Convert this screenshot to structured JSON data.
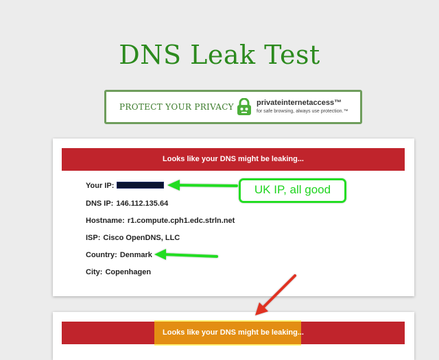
{
  "header": {
    "title": "DNS Leak Test"
  },
  "ad": {
    "tagline": "PROTECT YOUR PRIVACY",
    "brand": "privateinternetaccess™",
    "brand_sub": "for safe browsing, always use protection.™",
    "icon": "lock-icon"
  },
  "result_card": {
    "banner": "Looks like your DNS might be leaking...",
    "fields": [
      {
        "label": "Your IP:",
        "value": ""
      },
      {
        "label": "DNS IP:",
        "value": "146.112.135.64"
      },
      {
        "label": "Hostname:",
        "value": "r1.compute.cph1.edc.strln.net"
      },
      {
        "label": "ISP:",
        "value": "Cisco OpenDNS, LLC"
      },
      {
        "label": "Country:",
        "value": "Denmark"
      },
      {
        "label": "City:",
        "value": "Copenhagen"
      }
    ]
  },
  "second_card": {
    "banner": "Looks like your DNS might be leaking..."
  },
  "annotations": {
    "callout": "UK IP, all good"
  },
  "colors": {
    "title_green": "#2c8a1e",
    "banner_red": "#c0242c",
    "annotation_green": "#24dd24",
    "annotation_red": "#e03020",
    "highlight_yellow": "#ffe600"
  }
}
